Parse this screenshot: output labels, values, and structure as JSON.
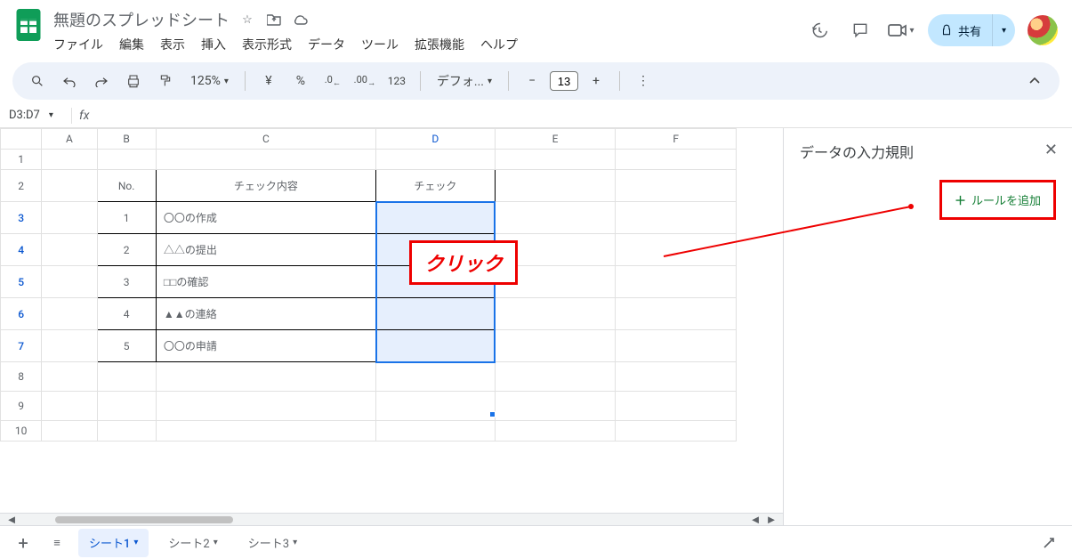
{
  "header": {
    "doc_title": "無題のスプレッドシート",
    "menus": [
      "ファイル",
      "編集",
      "表示",
      "挿入",
      "表示形式",
      "データ",
      "ツール",
      "拡張機能",
      "ヘルプ"
    ],
    "share_label": "共有"
  },
  "toolbar": {
    "zoom": "125%",
    "font": "デフォ...",
    "font_size": "13",
    "currency": "¥",
    "percent": "%",
    "dec_dec": ".0",
    "dec_inc": ".00",
    "format_123": "123"
  },
  "fx_bar": {
    "name_box": "D3:D7",
    "fx": "fx"
  },
  "grid": {
    "cols": [
      "A",
      "B",
      "C",
      "D",
      "E",
      "F"
    ],
    "rows": [
      "1",
      "2",
      "3",
      "4",
      "5",
      "6",
      "7",
      "8",
      "9",
      "10"
    ],
    "selected_col": "D",
    "selected_rows": [
      3,
      4,
      5,
      6,
      7
    ],
    "table_headers": {
      "no": "No.",
      "content": "チェック内容",
      "check": "チェック"
    },
    "table_rows": [
      {
        "no": "1",
        "content": "〇〇の作成",
        "check": ""
      },
      {
        "no": "2",
        "content": "△△の提出",
        "check": ""
      },
      {
        "no": "3",
        "content": "□□の確認",
        "check": ""
      },
      {
        "no": "4",
        "content": "▲▲の連絡",
        "check": ""
      },
      {
        "no": "5",
        "content": "〇〇の申請",
        "check": ""
      }
    ]
  },
  "side_panel": {
    "title": "データの入力規則",
    "add_rule": "ルールを追加"
  },
  "annotation": {
    "click_label": "クリック"
  },
  "tabs": {
    "sheets": [
      "シート1",
      "シート2",
      "シート3"
    ],
    "active": 0
  }
}
